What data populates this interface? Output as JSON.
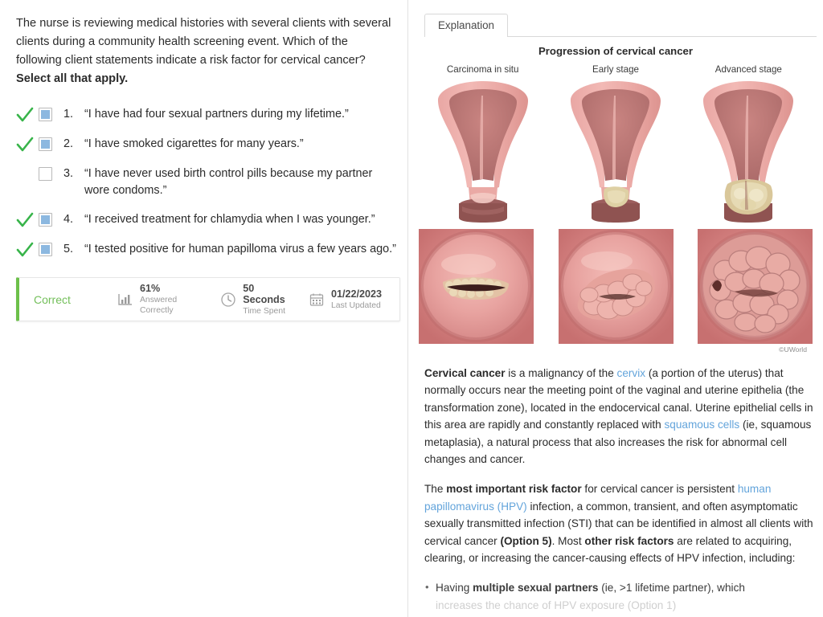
{
  "question": {
    "stem_part1": "The nurse is reviewing medical histories with several clients with several clients during a community health screening event.  Which of the following client statements indicate a risk factor for cervical cancer?  ",
    "stem_bold": "Select all that apply.",
    "options": [
      {
        "number": "1.",
        "text": "“I have had four sexual partners during my lifetime.”",
        "checked": true,
        "correct": true
      },
      {
        "number": "2.",
        "text": "“I have smoked cigarettes for many years.”",
        "checked": true,
        "correct": true
      },
      {
        "number": "3.",
        "text": "“I have never used birth control pills because my partner wore condoms.”",
        "checked": false,
        "correct": false
      },
      {
        "number": "4.",
        "text": "“I received treatment for chlamydia when I was younger.”",
        "checked": true,
        "correct": true
      },
      {
        "number": "5.",
        "text": "“I tested positive for human papilloma virus a few years ago.”",
        "checked": true,
        "correct": true
      }
    ]
  },
  "stats": {
    "verdict": "Correct",
    "verdict_color": "#73bf5a",
    "items": [
      {
        "icon": "bar-chart-icon",
        "value": "61%",
        "label": "Answered Correctly"
      },
      {
        "icon": "clock-icon",
        "value": "50 Seconds",
        "label": "Time Spent"
      },
      {
        "icon": "calendar-icon",
        "value": "01/22/2023",
        "label": "Last Updated"
      }
    ]
  },
  "right": {
    "tab_label": "Explanation",
    "figure": {
      "title": "Progression of cervical cancer",
      "stages": [
        "Carcinoma in situ",
        "Early stage",
        "Advanced stage"
      ],
      "copyright": "©UWorld"
    },
    "explanation": {
      "p1": [
        {
          "t": "Cervical cancer",
          "s": "b"
        },
        {
          "t": " is a malignancy of the ",
          "s": "n"
        },
        {
          "t": "cervix",
          "s": "l"
        },
        {
          "t": " (a portion of the uterus) that normally occurs near the meeting point of the vaginal and uterine epithelia (the transformation zone), located in the endocervical canal. Uterine epithelial cells in this area are rapidly and constantly replaced with ",
          "s": "n"
        },
        {
          "t": "squamous cells",
          "s": "l"
        },
        {
          "t": " (ie, squamous metaplasia), a natural process that also increases the risk for abnormal cell changes and cancer.",
          "s": "n"
        }
      ],
      "p2": [
        {
          "t": "The ",
          "s": "n"
        },
        {
          "t": "most important risk factor",
          "s": "b"
        },
        {
          "t": " for cervical cancer is persistent ",
          "s": "n"
        },
        {
          "t": "human papillomavirus (HPV)",
          "s": "l"
        },
        {
          "t": " infection, a common, transient, and often asymptomatic sexually transmitted infection (STI) that can be identified in almost all clients with cervical cancer ",
          "s": "n"
        },
        {
          "t": "(Option 5)",
          "s": "b"
        },
        {
          "t": ".  Most ",
          "s": "n"
        },
        {
          "t": "other risk factors",
          "s": "b"
        },
        {
          "t": " are related to acquiring, clearing, or increasing the cancer-causing effects of HPV infection, including:",
          "s": "n"
        }
      ],
      "bullets": [
        {
          "parts": [
            {
              "t": "Having ",
              "s": "n"
            },
            {
              "t": "multiple sexual partners",
              "s": "b"
            },
            {
              "t": " (ie, >1 lifetime partner), which",
              "s": "n"
            }
          ],
          "cut_off_line": "increases the chance of HPV exposure (Option 1)"
        }
      ]
    }
  },
  "colors": {
    "accent_green": "#6cc04a",
    "link_blue": "#63a4db",
    "checkbox_fill": "#8cb8e0",
    "check_green": "#38b44a"
  }
}
